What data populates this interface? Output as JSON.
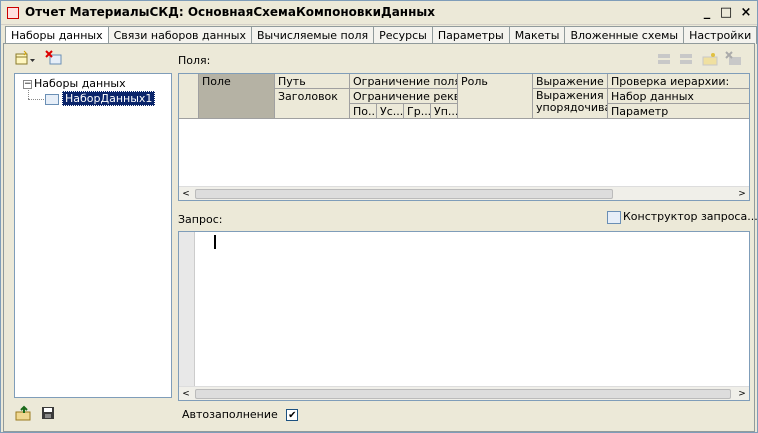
{
  "window": {
    "title": "Отчет МатериалыСКД: ОсновнаяСхемаКомпоновкиДанных"
  },
  "titlebar_buttons": {
    "minimize": "_",
    "maximize": "□",
    "close": "×"
  },
  "tabs": [
    {
      "label": "Наборы данных",
      "active": true
    },
    {
      "label": "Связи наборов данных"
    },
    {
      "label": "Вычисляемые поля"
    },
    {
      "label": "Ресурсы"
    },
    {
      "label": "Параметры"
    },
    {
      "label": "Макеты"
    },
    {
      "label": "Вложенные схемы"
    },
    {
      "label": "Настройки"
    }
  ],
  "tree": {
    "root_label": "Наборы данных",
    "root_toggle": "−",
    "child_label": "НаборДанных1"
  },
  "fields": {
    "label": "Поля:",
    "columns": {
      "field": "Поле",
      "path": "Путь",
      "title": "Заголовок",
      "field_restriction": "Ограничение поля",
      "attr_restriction": "Ограничение рекв...",
      "sub1": "По...",
      "sub2": "Ус...",
      "sub3": "Гр...",
      "sub4": "Уп...",
      "role": "Роль",
      "expression": "Выражение ...",
      "order_expression": "Выражения упорядочива...",
      "hierarchy_check": "Проверка иерархии:",
      "dataset": "Набор данных",
      "parameter": "Параметр"
    }
  },
  "query": {
    "label": "Запрос:",
    "constructor_label": "Конструктор запроса..."
  },
  "autofill": {
    "label": "Автозаполнение",
    "checked": true
  },
  "scroll": {
    "left": "<",
    "right": ">"
  },
  "colors": {
    "selection": "#0a246a",
    "border": "#7f9db9",
    "panel": "#ece9d8"
  }
}
